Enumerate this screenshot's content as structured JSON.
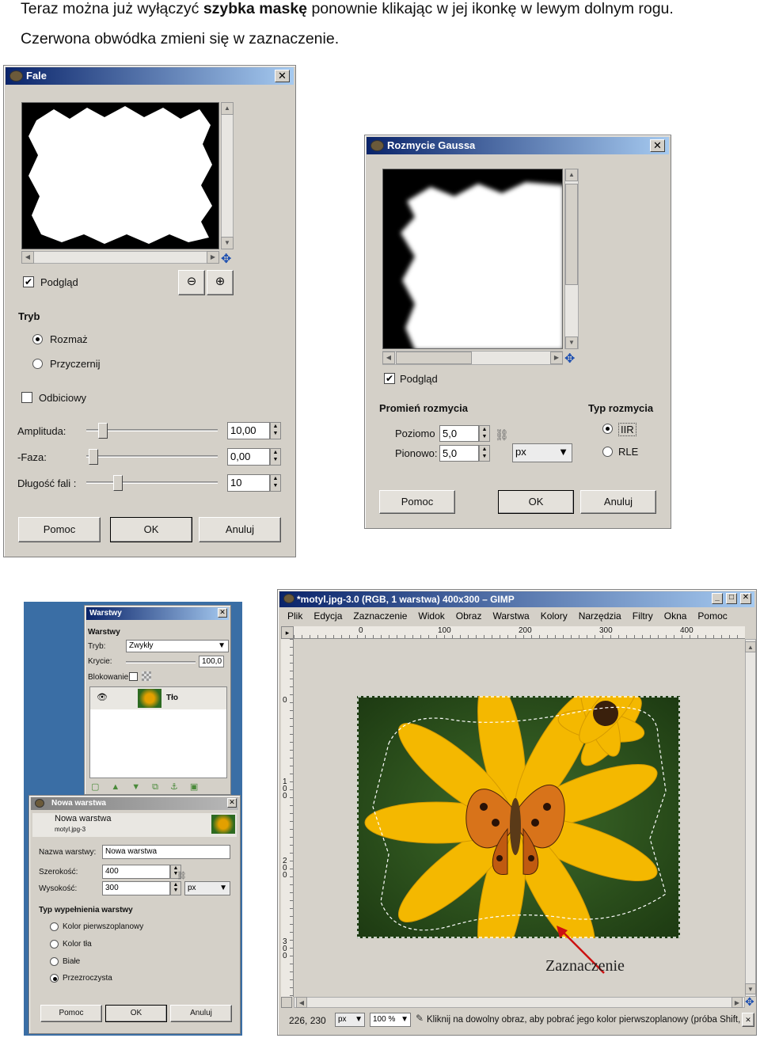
{
  "doc": {
    "line1_pre": "Teraz można już wyłączyć",
    "line1_bold": "szybka maskę",
    "line1_post": "ponownie klikając w jej ikonkę w lewym dolnym rogu.",
    "line2": "Czerwona obwódka zmieni się w zaznaczenie."
  },
  "fale": {
    "title": "Fale",
    "close": "✕",
    "preview_label": "Podgląd",
    "mode_heading": "Tryb",
    "mode_options": [
      "Rozmaż",
      "Przyczernij"
    ],
    "mode_selected": 0,
    "reflective_label": "Odbiciowy",
    "params": [
      {
        "label": "Amplituda:",
        "value": "10,00",
        "level": 0.1
      },
      {
        "label": "-Faza:",
        "value": "0,00",
        "level": 0.02
      },
      {
        "label": "Długość fali :",
        "value": "10",
        "level": 0.22
      }
    ],
    "buttons": {
      "help": "Pomoc",
      "ok": "OK",
      "cancel": "Anuluj"
    }
  },
  "gauss": {
    "title": "Rozmycie Gaussa",
    "close": "✕",
    "preview_label": "Podgląd",
    "radius_heading": "Promień rozmycia",
    "horizontal_label": "Poziomo",
    "horizontal_value": "5,0",
    "vertical_label": "Pionowo:",
    "vertical_value": "5,0",
    "unit": "px",
    "type_heading": "Typ rozmycia",
    "type_options": [
      "IIR",
      "RLE"
    ],
    "type_selected": 0,
    "buttons": {
      "help": "Pomoc",
      "ok": "OK",
      "cancel": "Anuluj"
    }
  },
  "layers": {
    "title": "Warstwy",
    "heading": "Warstwy",
    "mode_label": "Tryb:",
    "mode_value": "Zwykły",
    "opacity_label": "Krycie:",
    "opacity_value": "100,0",
    "lock_label": "Blokowanie:",
    "layer_name": "Tło"
  },
  "new_layer": {
    "title": "Nowa warstwa",
    "header": "Nowa warstwa",
    "subheader": "motyl.jpg-3",
    "name_label": "Nazwa warstwy:",
    "name_value": "Nowa warstwa",
    "width_label": "Szerokość:",
    "width_value": "400",
    "height_label": "Wysokość:",
    "height_value": "300",
    "unit": "px",
    "fill_heading": "Typ wypełnienia warstwy",
    "fill_options": [
      "Kolor pierwszoplanowy",
      "Kolor tła",
      "Białe",
      "Przezroczysta"
    ],
    "fill_selected": 3,
    "buttons": {
      "help": "Pomoc",
      "ok": "OK",
      "cancel": "Anuluj"
    }
  },
  "gimp": {
    "title": "*motyl.jpg-3.0 (RGB, 1 warstwa) 400x300 – GIMP",
    "menu": [
      "Plik",
      "Edycja",
      "Zaznaczenie",
      "Widok",
      "Obraz",
      "Warstwa",
      "Kolory",
      "Narzędzia",
      "Filtry",
      "Okna",
      "Pomoc"
    ],
    "ruler_h": [
      "0",
      "100",
      "200",
      "300",
      "400"
    ],
    "ruler_v": [
      "0",
      "100",
      "200",
      "300"
    ],
    "coords": "226, 230",
    "unit": "px",
    "zoom": "100 %",
    "status": "Kliknij na dowolny obraz, aby pobrać jego kolor pierwszoplanowy (próba Shift,",
    "annotation": "Zaznaczenie",
    "colors": {
      "title_bar": "#0a246a",
      "annotation_arrow": "#cc1111"
    }
  }
}
